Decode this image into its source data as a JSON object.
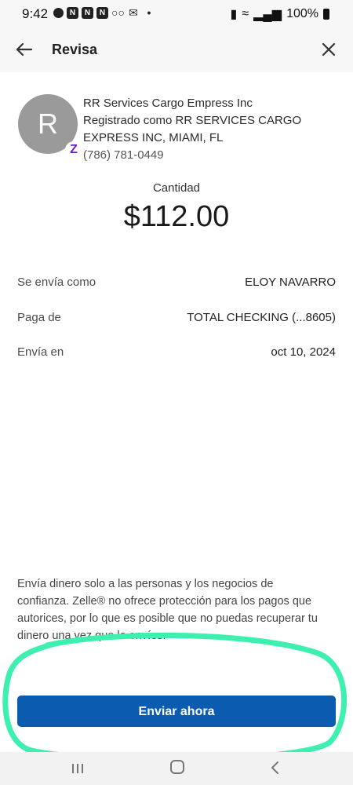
{
  "status_bar": {
    "time": "9:42",
    "battery_text": "100%",
    "icons": [
      "chat-icon",
      "nyt-icon",
      "nyt-icon",
      "nyt-icon",
      "voicemail-icon",
      "mail-icon",
      "dot-icon"
    ]
  },
  "header": {
    "title": "Revisa"
  },
  "recipient": {
    "avatar_letter": "R",
    "name": "RR Services Cargo Empress Inc",
    "registered_line1": "Registrado como RR SERVICES CARGO",
    "registered_line2": "EXPRESS INC, MIAMI, FL",
    "phone": "(786) 781-0449",
    "badge": "Z"
  },
  "amount": {
    "label": "Cantidad",
    "value": "$112.00"
  },
  "details": [
    {
      "label": "Se envía como",
      "value": "ELOY NAVARRO"
    },
    {
      "label": "Paga de",
      "value": "TOTAL CHECKING (...8605)"
    },
    {
      "label": "Envía en",
      "value": "oct 10, 2024"
    }
  ],
  "disclaimer": "Envía dinero solo a las personas y los negocios de confianza. Zelle® no ofrece protección para los pagos que autorices, por lo que es posible que no puedas recuperar tu dinero una vez que lo envíes.",
  "actions": {
    "send_label": "Enviar ahora"
  },
  "colors": {
    "primary_button": "#0b5cb0",
    "zelle_purple": "#6d1ed4",
    "annotation_green": "#3ef0b0",
    "avatar_gray": "#9a9a9a"
  }
}
